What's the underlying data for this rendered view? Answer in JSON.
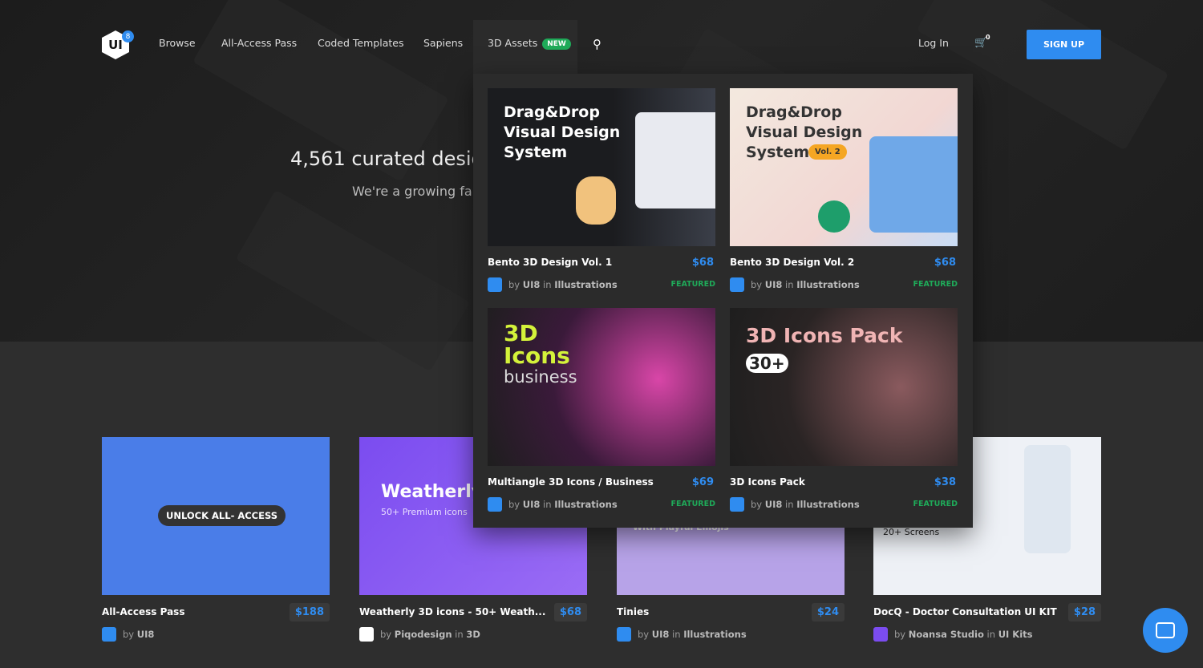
{
  "nav": {
    "logo": "UI",
    "logo_badge": "8",
    "items": [
      "Browse",
      "All-Access Pass",
      "Coded Templates",
      "Sapiens",
      "3D Assets"
    ],
    "new_badge": "NEW",
    "login": "Log In",
    "cart_count": "0",
    "signup": "SIGN UP"
  },
  "hero": {
    "title": "4,561 curated desig",
    "subtitle": "We're a growing fa"
  },
  "dropdown": [
    {
      "title": "Bento 3D Design Vol. 1",
      "price": "$68",
      "by": "by",
      "author": "UI8",
      "in": "in",
      "category": "Illustrations",
      "badge": "FEATURED",
      "thumb_text": "Drag&Drop Visual Design System",
      "thumb_tag": ""
    },
    {
      "title": "Bento 3D Design Vol. 2",
      "price": "$68",
      "by": "by",
      "author": "UI8",
      "in": "in",
      "category": "Illustrations",
      "badge": "FEATURED",
      "thumb_text": "Drag&Drop Visual Design System",
      "thumb_tag": "Vol. 2"
    },
    {
      "title": "Multiangle 3D Icons / Business",
      "price": "$69",
      "by": "by",
      "author": "UI8",
      "in": "in",
      "category": "Illustrations",
      "badge": "FEATURED",
      "thumb_text": "3D Icons",
      "thumb_tag": "business"
    },
    {
      "title": "3D Icons Pack",
      "price": "$38",
      "by": "by",
      "author": "UI8",
      "in": "in",
      "category": "Illustrations",
      "badge": "FEATURED",
      "thumb_text": "3D Icons Pack",
      "thumb_tag": "30+"
    }
  ],
  "products": [
    {
      "title": "All-Access Pass",
      "price": "$188",
      "by": "by",
      "author": "UI8",
      "in": "",
      "category": "",
      "thumb_text": "UNLOCK ALL- ACCESS"
    },
    {
      "title": "Weatherly 3D icons - 50+ Weath...",
      "price": "$68",
      "by": "by",
      "author": "Piqodesign",
      "in": "in",
      "category": "3D",
      "thumb_text": "Weatherly.",
      "thumb_sub": "50+ Premium icons"
    },
    {
      "title": "Tinies",
      "price": "$24",
      "by": "by",
      "author": "UI8",
      "in": "in",
      "category": "Illustrations",
      "thumb_text": "With Playful Emojis"
    },
    {
      "title": "DocQ - Doctor Consultation UI KIT",
      "price": "$28",
      "by": "by",
      "author": "Noansa Studio",
      "in": "in",
      "category": "UI Kits",
      "thumb_text": "20+ Screens"
    }
  ],
  "colors": {
    "accent": "#2f8cf0",
    "featured": "#1faa59"
  }
}
